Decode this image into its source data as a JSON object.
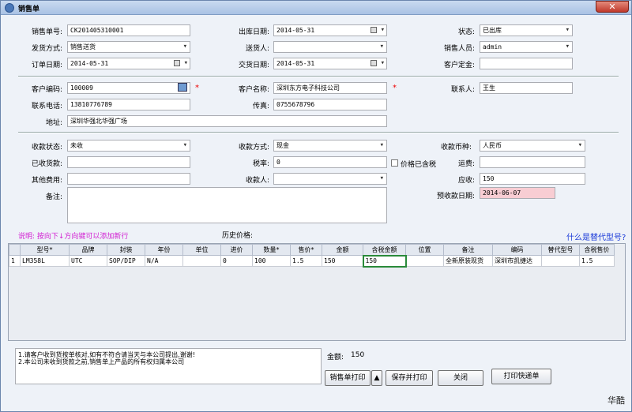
{
  "window": {
    "title": "销售单",
    "close_glyph": "✕"
  },
  "order": {
    "order_no_label": "销售单号:",
    "order_no": "CK201405310001",
    "out_date_label": "出库日期:",
    "out_date": "2014-05-31",
    "status_label": "状态:",
    "status": "已出库",
    "ship_method_label": "发货方式:",
    "ship_method": "销售送货",
    "sender_label": "送货人:",
    "sender": "",
    "salesperson_label": "销售人员:",
    "salesperson": "admin",
    "order_date_label": "订单日期:",
    "order_date": "2014-05-31",
    "deal_date_label": "交货日期:",
    "deal_date": "2014-05-31",
    "deposit_label": "客户定金:",
    "deposit": ""
  },
  "customer": {
    "code_label": "客户编码:",
    "code": "100009",
    "name_label": "客户名称:",
    "name": "深圳东方电子科技公司",
    "contact_label": "联系人:",
    "contact": "王生",
    "phone_label": "联系电话:",
    "phone": "13810776789",
    "fax_label": "传真:",
    "fax": "0755678796",
    "address_label": "地址:",
    "address": "深圳华强北华强广场",
    "required_mark": "*"
  },
  "payment": {
    "status_label": "收款状态:",
    "status": "未收",
    "method_label": "收款方式:",
    "method": "现金",
    "currency_label": "收款币种:",
    "currency": "人民币",
    "received_label": "已收货款:",
    "received": "",
    "tax_label": "税率:",
    "tax": "0",
    "tax_included_label": "价格已含税",
    "freight_label": "运费:",
    "freight": "",
    "other_label": "其他费用:",
    "other": "",
    "payee_label": "收款人:",
    "payee": "",
    "receivable_label": "应收:",
    "receivable": "150",
    "remark_label": "备注:",
    "remark": "",
    "pred_date_label": "预收款日期:",
    "pred_date": "2014-06-07"
  },
  "hints": {
    "tip": "说明: 按向下↓方向键可以添加新行",
    "history_label": "历史价格:",
    "alt_link": "什么是替代型号?"
  },
  "table": {
    "headers": [
      "型号*",
      "品牌",
      "封装",
      "年份",
      "单位",
      "进价",
      "数量*",
      "售价*",
      "金额",
      "含税金额",
      "位置",
      "备注",
      "编码",
      "替代型号",
      "含税售价"
    ],
    "rows": [
      [
        "1",
        "LM358L",
        "UTC",
        "SOP/DIP",
        "N/A",
        "",
        "0",
        "100",
        "1.5",
        "150",
        "150",
        "",
        "全新原装现货",
        "深圳市凯捷达",
        "",
        "1.5"
      ]
    ]
  },
  "footer": {
    "terms_line1": "1.请客户收到货按单核对,如有不符合请当天与本公司提出,谢谢!",
    "terms_line2": "2.本公司未收到货款之前,销售单上产品的所有权归属本公司",
    "total_label": "金额:",
    "total": "150",
    "print_btn": "销售单打印",
    "print_arrow": "▲",
    "save_print_btn": "保存并打印",
    "close_btn": "关闭",
    "express_btn": "打印快递单",
    "brand": "华酷"
  }
}
